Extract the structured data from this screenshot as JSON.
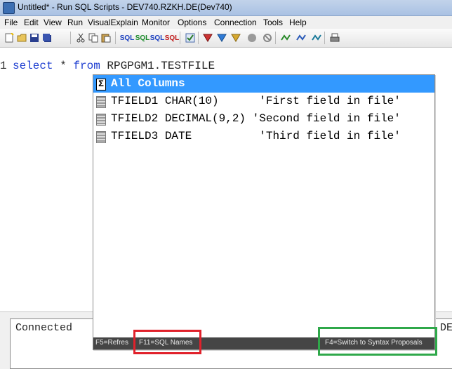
{
  "window": {
    "title": "Untitled* - Run SQL Scripts - DEV740.RZKH.DE(Dev740)"
  },
  "menu": [
    "File",
    "Edit",
    "View",
    "Run",
    "VisualExplain",
    "Monitor",
    "Options",
    "Connection",
    "Tools",
    "Help"
  ],
  "toolbar": {
    "icons": [
      "new-script-icon",
      "open-icon",
      "save-icon",
      "save-all-icon",
      "cut-icon",
      "copy-icon",
      "paste-icon",
      "sql-run-all-icon",
      "sql-run-from-icon",
      "sql-run-selected-icon",
      "sql-stop-icon",
      "sql-check-icon",
      "explain-icon",
      "explain-run-icon",
      "explain-visual-icon",
      "stop-icon",
      "cancel-icon",
      "monitor-start-icon",
      "monitor-stop-icon",
      "monitor-view-icon",
      "print-icon"
    ],
    "sql_label": "SQL"
  },
  "editor": {
    "line_number": "1",
    "tokens": {
      "kw1": "select",
      "star": " * ",
      "kw2": "from",
      "table": " RPGPGM1.TESTFILE"
    }
  },
  "popup": {
    "rows": [
      {
        "text": "All Columns",
        "icon": "sigma-icon"
      },
      {
        "text": "TFIELD1 CHAR(10)      'First field in file'",
        "icon": "column-icon"
      },
      {
        "text": "TFIELD2 DECIMAL(9,2) 'Second field in file'",
        "icon": "column-icon"
      },
      {
        "text": "TFIELD3 DATE          'Third field in file'",
        "icon": "column-icon"
      }
    ],
    "footer": {
      "refresh": "F5=Refres",
      "sql_names": "F11=SQL Names",
      "syntax": "F4=Switch to Syntax Proposals"
    }
  },
  "status": {
    "text": "Connected",
    "right": "DE"
  },
  "colors": {
    "selection": "#3399ff",
    "keyword": "#1f3fd1",
    "highlight_red": "#e0212b",
    "highlight_green": "#2fa84a"
  }
}
